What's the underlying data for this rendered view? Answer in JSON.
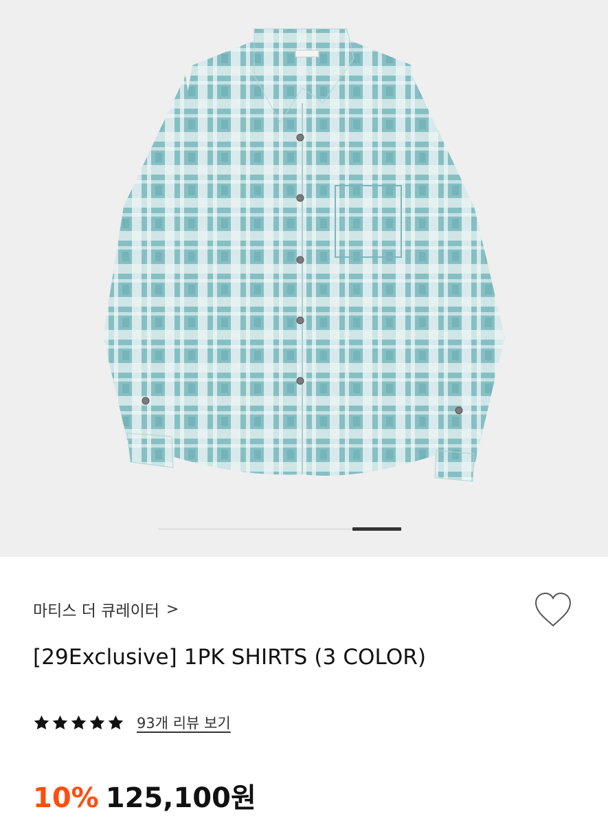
{
  "product_image": {
    "alt": "",
    "pager": {
      "current": 5,
      "total": 5
    }
  },
  "brand": {
    "name": "마티스 더 큐레이터",
    "chevron": ">"
  },
  "wishlist": {
    "icon": "heart-outline-icon"
  },
  "product": {
    "title": "[29Exclusive] 1PK SHIRTS (3 COLOR)"
  },
  "rating": {
    "stars": 5,
    "icon": "star-icon",
    "review_link": "93개 리뷰 보기"
  },
  "price": {
    "discount": "10%",
    "amount": "125,100원"
  },
  "colors": {
    "discount": "#ff4d0d",
    "hero_background": "#efefef",
    "shirt": "#8fc3c6"
  }
}
